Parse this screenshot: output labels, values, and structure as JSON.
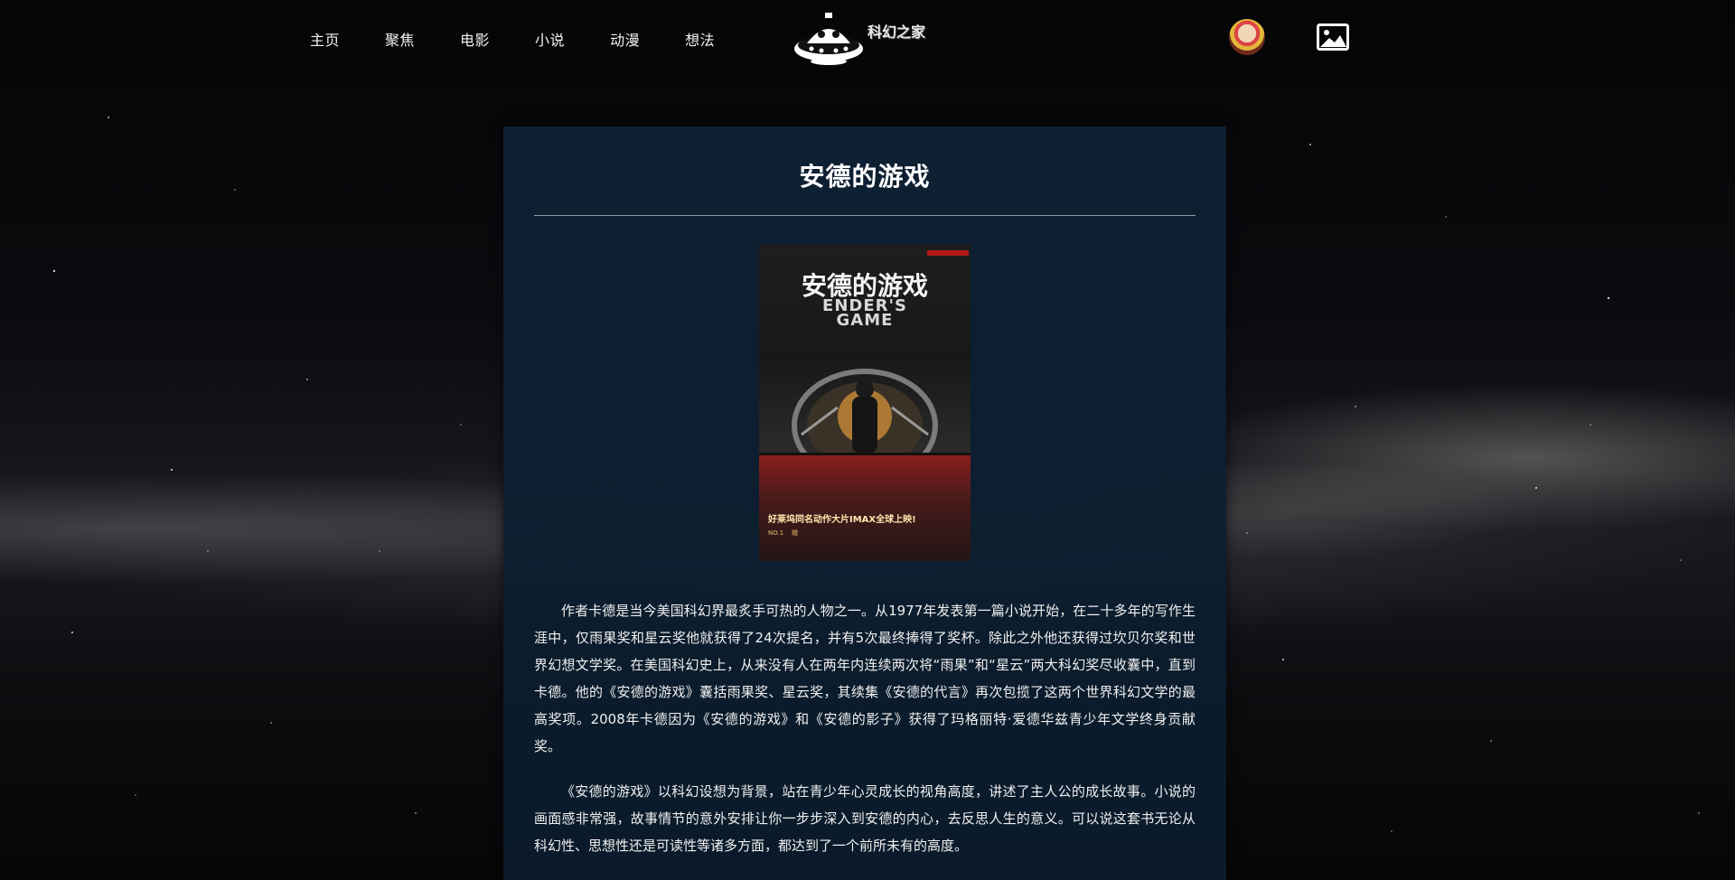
{
  "nav": {
    "links": [
      "主页",
      "聚焦",
      "电影",
      "小说",
      "动漫",
      "想法"
    ]
  },
  "logo": {
    "text": "科幻之家",
    "icon": "ufo-icon"
  },
  "header_right": {
    "avatar_icon": "user-avatar",
    "gallery_icon": "image-icon"
  },
  "article": {
    "title": "安德的游戏",
    "cover": {
      "title_cn": "安德的游戏",
      "title_en_line1": "ENDER'S",
      "title_en_line2": "GAME",
      "banner_headline": "好莱坞同名动作大片IMAX全球上映!",
      "banner_badge": "赠",
      "banner_sub": "NO.1"
    },
    "paragraphs": [
      "作者卡德是当今美国科幻界最炙手可热的人物之一。从1977年发表第一篇小说开始，在二十多年的写作生涯中，仅雨果奖和星云奖他就获得了24次提名，并有5次最终捧得了奖杯。除此之外他还获得过坎贝尔奖和世界幻想文学奖。在美国科幻史上，从来没有人在两年内连续两次将“雨果”和“星云”两大科幻奖尽收囊中，直到卡德。他的《安德的游戏》囊括雨果奖、星云奖，其续集《安德的代言》再次包揽了这两个世界科幻文学的最高奖项。2008年卡德因为《安德的游戏》和《安德的影子》获得了玛格丽特·爱德华兹青少年文学终身贡献奖。",
      "《安德的游戏》以科幻设想为背景，站在青少年心灵成长的视角高度，讲述了主人公的成长故事。小说的画面感非常强，故事情节的意外安排让你一步步深入到安德的内心，去反思人生的意义。可以说这套书无论从科幻性、思想性还是可读性等诸多方面，都达到了一个前所未有的高度。"
    ]
  },
  "colors": {
    "panel_bg": "#0e2134",
    "text": "#f0f0f0",
    "divider": "#8e9aa5"
  }
}
